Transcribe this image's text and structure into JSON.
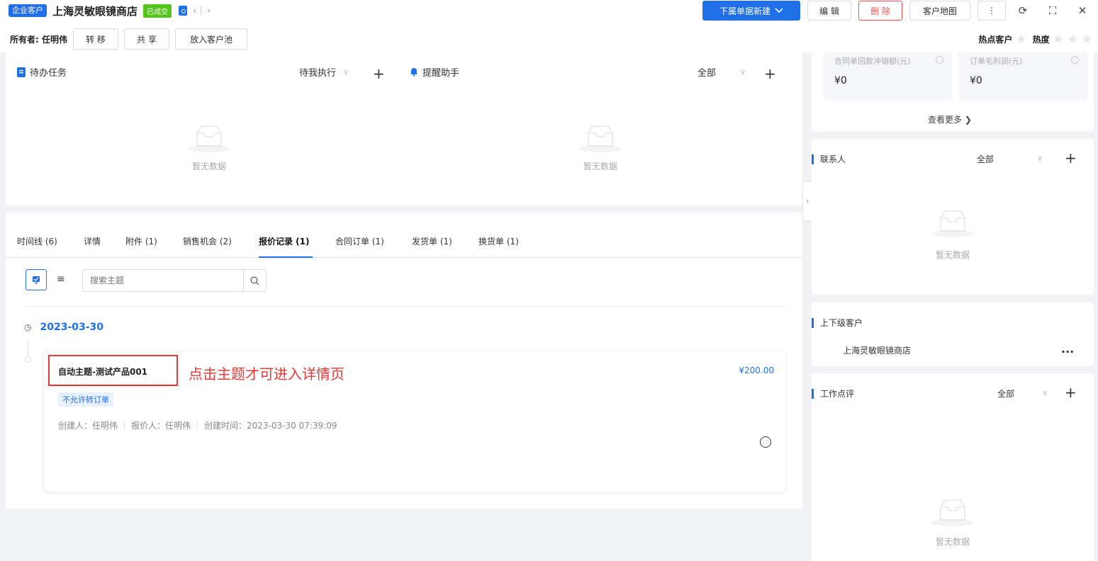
{
  "header": {
    "type_tag": "企业客户",
    "customer_name": "上海灵敏眼镜商店",
    "status_tag": "已成交",
    "nav_prev": "‹",
    "nav_next": "›",
    "new_sub_label": "下属单据新建",
    "edit_label": "编 辑",
    "delete_label": "删 除",
    "map_label": "客户地图",
    "more_icon": "⋮",
    "refresh_icon": "⟳",
    "fullscreen_icon": "⛶",
    "close_icon": "✕",
    "owner_label": "所有者: 任明伟",
    "transfer_label": "转 移",
    "share_label": "共 享",
    "pool_label": "放入客户池",
    "hot_label": "热点客户",
    "heat_label": "热度",
    "heat_stars": 0,
    "heat_max": 3
  },
  "todo_panel": {
    "title": "待办任务",
    "filter": "待我执行",
    "plus": "+",
    "empty_text": "暂无数据"
  },
  "reminder_panel": {
    "title": "提醒助手",
    "filter": "全部",
    "plus": "+",
    "empty_text": "暂无数据"
  },
  "tabs": [
    {
      "label": "时间线 (6)"
    },
    {
      "label": "详情"
    },
    {
      "label": "附件 (1)"
    },
    {
      "label": "销售机会 (2)"
    },
    {
      "label": "报价记录 (1)"
    },
    {
      "label": "合同订单 (1)"
    },
    {
      "label": "发货单 (1)"
    },
    {
      "label": "换货单 (1)"
    }
  ],
  "active_tab": "报价记录 (1)",
  "search": {
    "placeholder": "搜索主题",
    "value": ""
  },
  "timeline": {
    "date": "2023-03-30",
    "record": {
      "title": "自动主题-测试产品001",
      "amount": "¥200.00",
      "badge": "不允许转订单",
      "creator": "创建人：任明伟",
      "quoter": "报价人：任明伟",
      "created_time": "创建时间：2023-03-30 07:39:09"
    },
    "annotation": "点击主题才可进入详情页"
  },
  "right": {
    "stats": [
      {
        "label": "合同单回款冲销额(元)",
        "value": "¥0"
      },
      {
        "label": "订单毛利润(元)",
        "value": "¥0"
      }
    ],
    "view_more": "查看更多",
    "contacts": {
      "title": "联系人",
      "filter": "全部",
      "plus": "+",
      "empty_text": "暂无数据"
    },
    "parent_child": {
      "title": "上下级客户",
      "item": "上海灵敏眼镜商店",
      "more": "..."
    },
    "comments": {
      "title": "工作点评",
      "filter": "全部",
      "plus": "+",
      "empty_text": "暂无数据"
    }
  },
  "colors": {
    "primary": "#1f6fe8",
    "danger": "#ff4d4f",
    "success": "#52c41a",
    "annotation": "#e53935"
  }
}
